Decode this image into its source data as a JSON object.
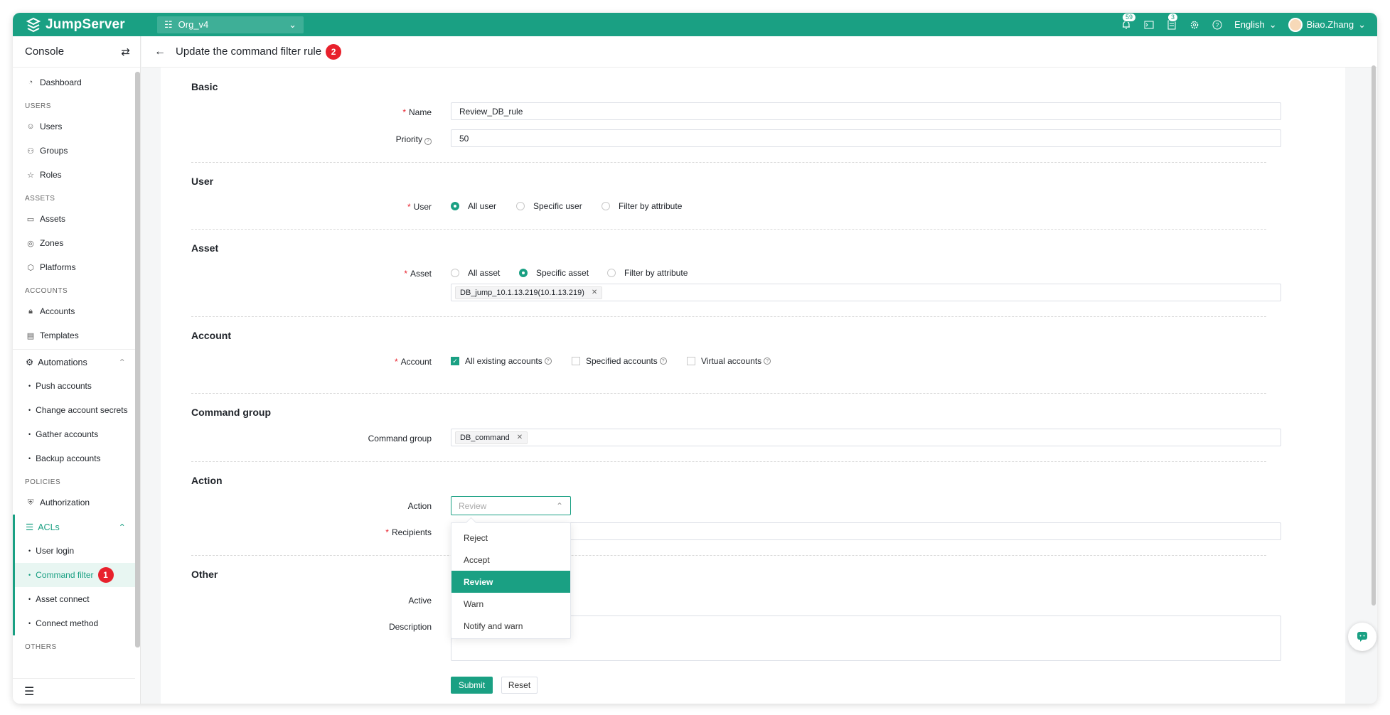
{
  "app": {
    "name": "JumpServer",
    "org": "Org_v4"
  },
  "topbar": {
    "notif_count": "59",
    "tasks_count": "3",
    "language": "English",
    "user": "Biao.Zhang"
  },
  "sidebar": {
    "title": "Console",
    "dashboard": "Dashboard",
    "groups": {
      "users": "USERS",
      "assets": "ASSETS",
      "accounts": "ACCOUNTS",
      "policies": "POLICIES",
      "others": "OTHERS"
    },
    "users_items": [
      "Users",
      "Groups",
      "Roles"
    ],
    "assets_items": [
      "Assets",
      "Zones",
      "Platforms"
    ],
    "accounts_items": [
      "Accounts",
      "Templates"
    ],
    "automations": "Automations",
    "automations_items": [
      "Push accounts",
      "Change account secrets",
      "Gather accounts",
      "Backup accounts"
    ],
    "authorization": "Authorization",
    "acls": "ACLs",
    "acls_items": [
      "User login",
      "Command filter",
      "Asset connect",
      "Connect method"
    ],
    "step_marker": "1"
  },
  "page": {
    "title": "Update the command filter rule",
    "step_marker": "2"
  },
  "form": {
    "basic": "Basic",
    "name_label": "Name",
    "name_value": "Review_DB_rule",
    "priority_label": "Priority",
    "priority_value": "50",
    "user_section": "User",
    "user_label": "User",
    "user_options": [
      "All user",
      "Specific user",
      "Filter by attribute"
    ],
    "asset_section": "Asset",
    "asset_label": "Asset",
    "asset_options": [
      "All asset",
      "Specific asset",
      "Filter by attribute"
    ],
    "asset_tag": "DB_jump_10.1.13.219(10.1.13.219)",
    "account_section": "Account",
    "account_label": "Account",
    "account_options": [
      "All existing accounts",
      "Specified accounts",
      "Virtual accounts"
    ],
    "cmdgroup_section": "Command group",
    "cmdgroup_label": "Command group",
    "cmdgroup_tag": "DB_command",
    "action_section": "Action",
    "action_label": "Action",
    "action_placeholder": "Review",
    "action_options": [
      "Reject",
      "Accept",
      "Review",
      "Warn",
      "Notify and warn"
    ],
    "recipients_label": "Recipients",
    "other_section": "Other",
    "active_label": "Active",
    "description_label": "Description",
    "submit": "Submit",
    "reset": "Reset"
  },
  "colors": {
    "brand": "#1aa083",
    "marker": "#e8212c"
  }
}
